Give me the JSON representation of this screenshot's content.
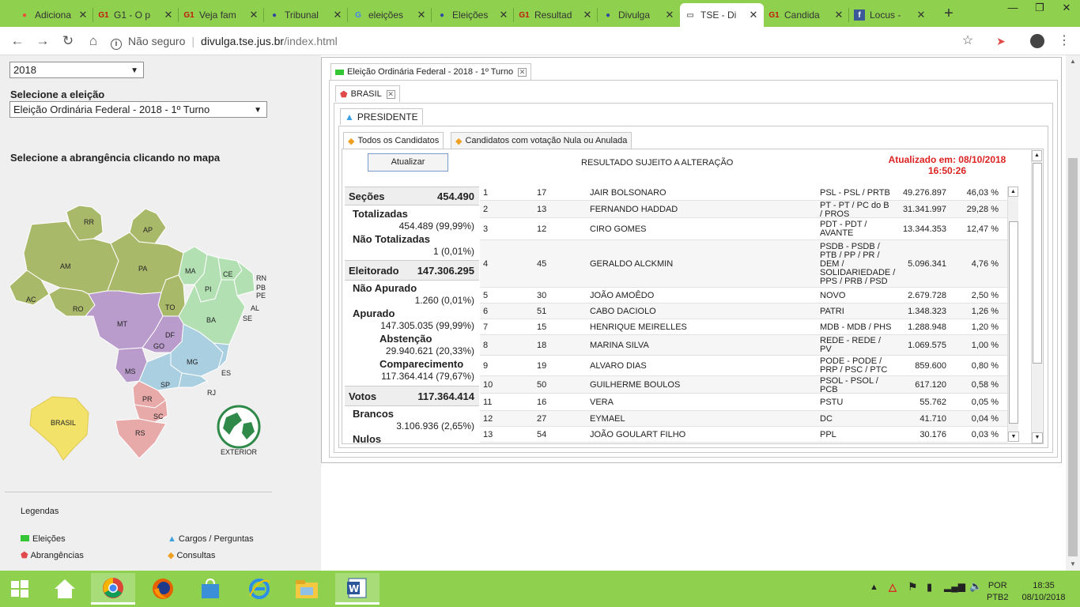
{
  "browser": {
    "tabs": [
      {
        "label": "Adiciona",
        "icon": "map-pin-icon"
      },
      {
        "label": "G1 - O p",
        "icon": "g1-icon"
      },
      {
        "label": "Veja fam",
        "icon": "g1-icon"
      },
      {
        "label": "Tribunal",
        "icon": "globe-icon"
      },
      {
        "label": "eleições",
        "icon": "google-icon"
      },
      {
        "label": "Eleições",
        "icon": "globe-icon"
      },
      {
        "label": "Resultad",
        "icon": "g1-icon"
      },
      {
        "label": "Divulga",
        "icon": "globe-icon"
      },
      {
        "label": "TSE - Di",
        "icon": "page-icon"
      },
      {
        "label": "Candida",
        "icon": "g1-icon"
      },
      {
        "label": "Locus -",
        "icon": "facebook-icon"
      }
    ],
    "new_tab": "+",
    "security": "Não seguro",
    "url_domain": "divulga.tse.jus.br",
    "url_path": "/index.html"
  },
  "left": {
    "year_value": "2018",
    "election_label": "Selecione a eleição",
    "election_value": "Eleição Ordinária Federal - 2018 - 1º Turno",
    "map_label": "Selecione a abrangência clicando no mapa",
    "states": [
      "RR",
      "AP",
      "AM",
      "PA",
      "MA",
      "CE",
      "RN",
      "PB",
      "PE",
      "AL",
      "SE",
      "PI",
      "AC",
      "RO",
      "TO",
      "BA",
      "MT",
      "DF",
      "GO",
      "MG",
      "ES",
      "RJ",
      "MS",
      "SP",
      "PR",
      "SC",
      "RS"
    ],
    "brasil_label": "BRASIL",
    "exterior_label": "EXTERIOR",
    "legend_title": "Legendas",
    "legend": {
      "eleicoes": "Eleições",
      "abrangencias": "Abrangências",
      "cargos": "Cargos / Perguntas",
      "consultas": "Consultas"
    },
    "colors": {
      "eleicoes": "#34c634",
      "abrangencias": "#e04a4a",
      "cargos": "#3ba0e0",
      "consultas": "#f0a020"
    }
  },
  "content": {
    "election_tab": "Eleição Ordinária Federal - 2018 - 1º Turno",
    "region_tab": "BRASIL",
    "office_tab": "PRESIDENTE",
    "sub_tab_all": "Todos os Candidatos",
    "sub_tab_null": "Candidatos com votação Nula ou Anulada",
    "refresh_button": "Atualizar",
    "notice": "RESULTADO SUJEITO A ALTERAÇÃO",
    "updated_line1": "Atualizado em: 08/10/2018",
    "updated_line2": "16:50:26",
    "stats": {
      "secoes_label": "Seções",
      "secoes_value": "454.490",
      "totalizadas_label": "Totalizadas",
      "totalizadas_value": "454.489 (99,99%)",
      "nao_totalizadas_label": "Não Totalizadas",
      "nao_totalizadas_value": "1 (0,01%)",
      "eleitorado_label": "Eleitorado",
      "eleitorado_value": "147.306.295",
      "nao_apurado_label": "Não Apurado",
      "nao_apurado_value": "1.260 (0,01%)",
      "apurado_label": "Apurado",
      "apurado_value": "147.305.035 (99,99%)",
      "abstencao_label": "Abstenção",
      "abstencao_value": "29.940.621 (20,33%)",
      "comparecimento_label": "Comparecimento",
      "comparecimento_value": "117.364.414 (79,67%)",
      "votos_label": "Votos",
      "votos_value": "117.364.414",
      "brancos_label": "Brancos",
      "brancos_value": "3.106.936 (2,65%)",
      "nulos_label": "Nulos"
    },
    "candidates": [
      {
        "seq": "1",
        "num": "17",
        "name": "JAIR BOLSONARO",
        "party": "PSL - PSL / PRTB",
        "votes": "49.276.897",
        "pct": "46,03 %"
      },
      {
        "seq": "2",
        "num": "13",
        "name": "FERNANDO HADDAD",
        "party": "PT - PT / PC do B\n/ PROS",
        "votes": "31.341.997",
        "pct": "29,28 %"
      },
      {
        "seq": "3",
        "num": "12",
        "name": "CIRO GOMES",
        "party": "PDT - PDT /\nAVANTE",
        "votes": "13.344.353",
        "pct": "12,47 %"
      },
      {
        "seq": "4",
        "num": "45",
        "name": "GERALDO ALCKMIN",
        "party": "PSDB - PSDB /\nPTB / PP / PR /\nDEM /\nSOLIDARIEDADE /\nPPS / PRB / PSD",
        "votes": "5.096.341",
        "pct": "4,76 %"
      },
      {
        "seq": "5",
        "num": "30",
        "name": "JOÃO AMOÊDO",
        "party": "NOVO",
        "votes": "2.679.728",
        "pct": "2,50 %"
      },
      {
        "seq": "6",
        "num": "51",
        "name": "CABO DACIOLO",
        "party": "PATRI",
        "votes": "1.348.323",
        "pct": "1,26 %"
      },
      {
        "seq": "7",
        "num": "15",
        "name": "HENRIQUE MEIRELLES",
        "party": "MDB - MDB / PHS",
        "votes": "1.288.948",
        "pct": "1,20 %"
      },
      {
        "seq": "8",
        "num": "18",
        "name": "MARINA SILVA",
        "party": "REDE - REDE /\nPV",
        "votes": "1.069.575",
        "pct": "1,00 %"
      },
      {
        "seq": "9",
        "num": "19",
        "name": "ALVARO DIAS",
        "party": "PODE - PODE /\nPRP / PSC / PTC",
        "votes": "859.600",
        "pct": "0,80 %"
      },
      {
        "seq": "10",
        "num": "50",
        "name": "GUILHERME BOULOS",
        "party": "PSOL - PSOL /\nPCB",
        "votes": "617.120",
        "pct": "0,58 %"
      },
      {
        "seq": "11",
        "num": "16",
        "name": "VERA",
        "party": "PSTU",
        "votes": "55.762",
        "pct": "0,05 %"
      },
      {
        "seq": "12",
        "num": "27",
        "name": "EYMAEL",
        "party": "DC",
        "votes": "41.710",
        "pct": "0,04 %"
      },
      {
        "seq": "13",
        "num": "54",
        "name": "JOÃO GOULART FILHO",
        "party": "PPL",
        "votes": "30.176",
        "pct": "0,03 %"
      }
    ]
  },
  "taskbar": {
    "lang1": "POR",
    "lang2": "PTB2",
    "time": "18:35",
    "date": "08/10/2018"
  }
}
